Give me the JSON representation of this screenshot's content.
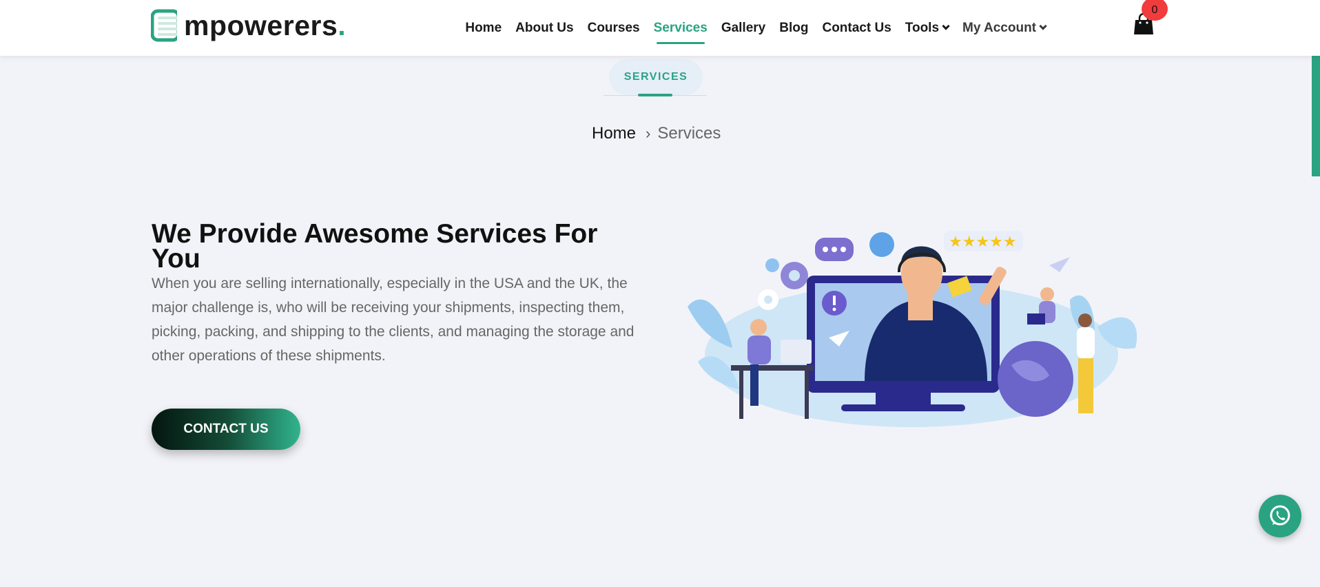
{
  "brand": {
    "logo_text": "mpowerers",
    "logo_dot": ".",
    "accent_color": "#2aa382"
  },
  "nav": {
    "items": [
      {
        "label": "Home"
      },
      {
        "label": "About Us"
      },
      {
        "label": "Courses"
      },
      {
        "label": "Services",
        "active": true
      },
      {
        "label": "Gallery"
      },
      {
        "label": "Blog"
      },
      {
        "label": "Contact Us"
      },
      {
        "label": "Tools",
        "dropdown": true
      },
      {
        "label": "My Account",
        "dropdown": true
      }
    ],
    "cart_count": "0"
  },
  "page": {
    "pill_label": "SERVICES",
    "breadcrumb": {
      "home": "Home",
      "current": "Services"
    }
  },
  "hero": {
    "title": "We Provide Awesome Services For You",
    "description": "When you are selling internationally, especially in the USA and the UK, the major challenge is, who will be receiving your shipments, inspecting them, picking, packing, and shipping to the clients, and managing the storage and other operations of these shipments.",
    "cta_label": "CONTACT US"
  },
  "icons": [
    "cart-icon",
    "chevron-down-icon",
    "chevron-right-icon",
    "whatsapp-icon",
    "logo-icon"
  ]
}
